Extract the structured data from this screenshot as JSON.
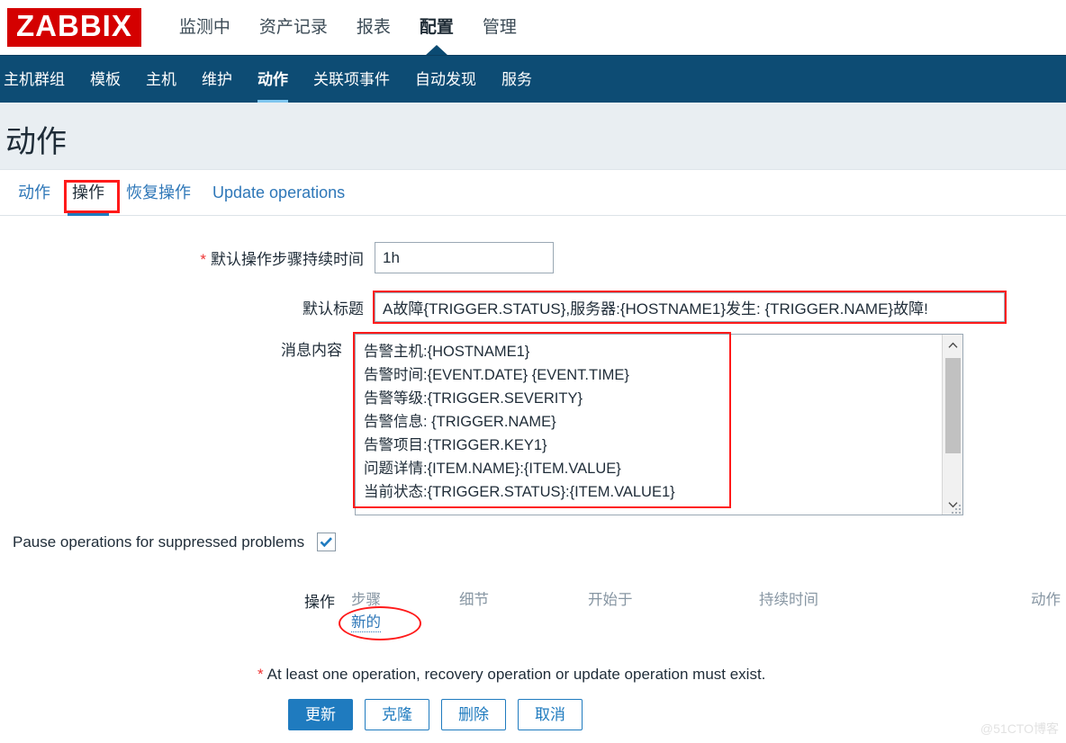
{
  "brand": {
    "logo_text": "ZABBIX",
    "logo_bg": "#d40000"
  },
  "topnav": {
    "items": [
      {
        "label": "监测中",
        "active": false
      },
      {
        "label": "资产记录",
        "active": false
      },
      {
        "label": "报表",
        "active": false
      },
      {
        "label": "配置",
        "active": true
      },
      {
        "label": "管理",
        "active": false
      }
    ]
  },
  "subnav": {
    "bg": "#0d4c74",
    "active_underline": "#7fc6ef",
    "items": [
      {
        "label": "主机群组"
      },
      {
        "label": "模板"
      },
      {
        "label": "主机"
      },
      {
        "label": "维护"
      },
      {
        "label": "动作"
      },
      {
        "label": "关联项事件"
      },
      {
        "label": "自动发现"
      },
      {
        "label": "服务"
      }
    ]
  },
  "page": {
    "title": "动作"
  },
  "tabs": {
    "items": [
      {
        "label": "动作",
        "active": false
      },
      {
        "label": "操作",
        "active": true
      },
      {
        "label": "恢复操作",
        "active": false
      },
      {
        "label": "Update operations",
        "active": false
      }
    ]
  },
  "form": {
    "duration": {
      "required_mark": "*",
      "label": "默认操作步骤持续时间",
      "value": "1h",
      "placeholder": ""
    },
    "subject": {
      "label": "默认标题",
      "value": "A故障{TRIGGER.STATUS},服务器:{HOSTNAME1}发生: {TRIGGER.NAME}故障!",
      "placeholder": ""
    },
    "message": {
      "label": "消息内容",
      "value": "告警主机:{HOSTNAME1}\n告警时间:{EVENT.DATE} {EVENT.TIME}\n告警等级:{TRIGGER.SEVERITY}\n告警信息: {TRIGGER.NAME}\n告警项目:{TRIGGER.KEY1}\n问题详情:{ITEM.NAME}:{ITEM.VALUE}\n当前状态:{TRIGGER.STATUS}:{ITEM.VALUE1}",
      "scrollbar": {
        "up_icon": "chevron-up-icon",
        "down_icon": "chevron-down-icon"
      },
      "resize_grip": "resize-grip-icon"
    },
    "pause": {
      "label": "Pause operations for suppressed problems",
      "checked": true,
      "check_icon": "check-icon"
    },
    "operations": {
      "label": "操作",
      "columns": [
        "步骤",
        "细节",
        "开始于",
        "持续时间",
        "动作"
      ],
      "rows": [],
      "new_link": "新的"
    },
    "footnote": {
      "required_mark": "*",
      "text": "At least one operation, recovery operation or update operation must exist."
    }
  },
  "buttons": [
    {
      "label": "更新",
      "primary": true
    },
    {
      "label": "克隆",
      "primary": false
    },
    {
      "label": "删除",
      "primary": false
    },
    {
      "label": "取消",
      "primary": false
    }
  ],
  "watermark": {
    "text": "@51CTO博客"
  },
  "annotations": {
    "tab_box": "红色方框-操作",
    "subject_box": "红色方框-默认标题",
    "message_box": "红色方框-消息内容",
    "new_ellipse": "红色椭圆-新的"
  }
}
